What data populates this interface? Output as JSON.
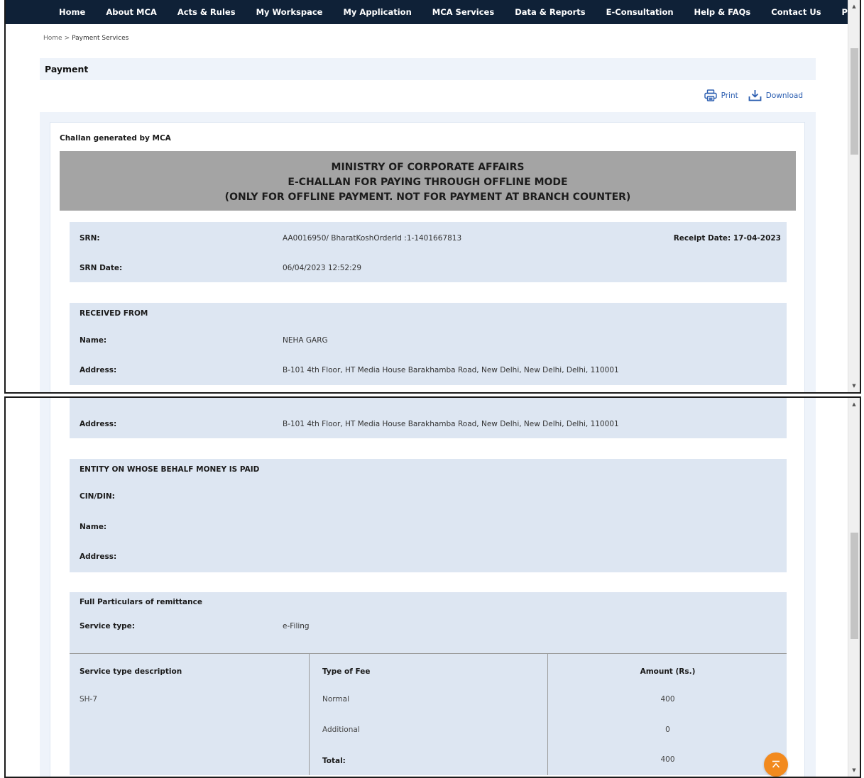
{
  "nav": {
    "items": [
      "Home",
      "About MCA",
      "Acts & Rules",
      "My Workspace",
      "My Application",
      "MCA Services",
      "Data & Reports",
      "E-Consultation",
      "Help & FAQs",
      "Contact Us",
      "Payment Services"
    ]
  },
  "breadcrumb": {
    "home": "Home",
    "separator": ">",
    "current": "Payment Services"
  },
  "page": {
    "title": "Payment"
  },
  "toolbar": {
    "print_label": "Print",
    "download_label": "Download"
  },
  "challan": {
    "caption": "Challan generated by MCA",
    "header": {
      "line1": "MINISTRY OF CORPORATE AFFAIRS",
      "line2": "E-CHALLAN FOR PAYING THROUGH OFFLINE MODE",
      "line3": "(ONLY FOR OFFLINE PAYMENT. NOT FOR PAYMENT AT BRANCH COUNTER)"
    },
    "srn": {
      "label": "SRN:",
      "value": "AA0016950/ BharatKoshOrderId :1-1401667813",
      "receipt_date": "Receipt Date: 17-04-2023",
      "date_label": "SRN Date:",
      "date_value": "06/04/2023 12:52:29"
    },
    "received_from": {
      "heading": "RECEIVED FROM",
      "name_label": "Name:",
      "name_value": "NEHA GARG",
      "address_label": "Address:",
      "address_value": "B-101 4th Floor, HT Media House Barakhamba Road, New Delhi, New Delhi, Delhi, 110001"
    },
    "entity": {
      "heading": "ENTITY ON WHOSE BEHALF MONEY IS PAID",
      "cin_label": "CIN/DIN:",
      "name_label": "Name:",
      "address_label": "Address:"
    },
    "remittance": {
      "heading": "Full Particulars of remittance",
      "service_type_label": "Service type:",
      "service_type_value": "e-Filing"
    },
    "fee_table": {
      "headers": [
        "Service type description",
        "Type of Fee",
        "Amount (Rs.)"
      ],
      "description": "SH-7",
      "rows": [
        {
          "type": "Normal",
          "amount": "400"
        },
        {
          "type": "Additional",
          "amount": "0"
        }
      ],
      "total_label": "Total:",
      "total_amount": "400"
    }
  },
  "colors": {
    "nav_bg": "#0f2137",
    "panel_bg": "#eef3fa",
    "block_bg": "#dde6f2",
    "header_grey": "#a4a4a4",
    "link_blue": "#2a5db0",
    "back_to_top": "#f28a1e"
  },
  "icons": [
    "printer-icon",
    "download-icon",
    "arrow-up-icon"
  ]
}
